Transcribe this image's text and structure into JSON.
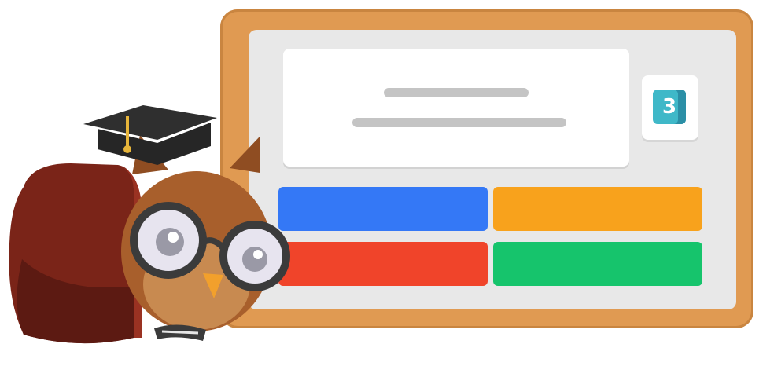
{
  "question_card": {
    "number_badge": "3"
  },
  "answers": [
    {
      "id": "blue",
      "color": "#3478f6"
    },
    {
      "id": "orange",
      "color": "#f8a21c"
    },
    {
      "id": "red",
      "color": "#f0442a"
    },
    {
      "id": "green",
      "color": "#16c46c"
    }
  ],
  "mascot": {
    "icon": "owl-graduate-icon"
  },
  "colors": {
    "frame": "#e09a52",
    "board": "#e8e8e8",
    "badge": "#3fb8c8"
  }
}
